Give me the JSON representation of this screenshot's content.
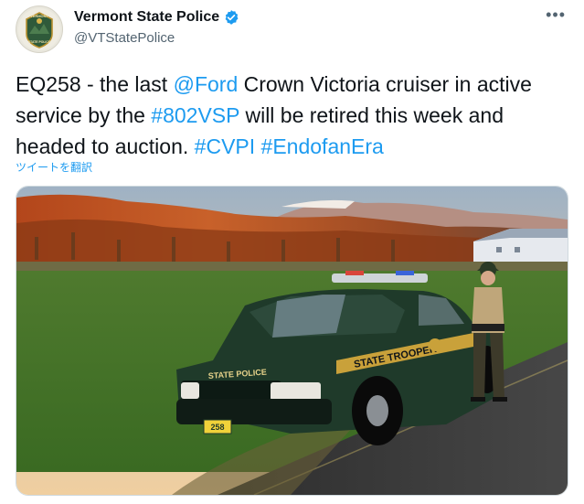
{
  "account": {
    "display_name": "Vermont State Police",
    "handle": "@VTStatePolice",
    "verified": true,
    "avatar_icon": "vermont-state-police-badge",
    "avatar_text_top": "VERMONT",
    "avatar_text_bottom": "STATE POLICE"
  },
  "menu": {
    "more_label": "•••"
  },
  "tweet": {
    "segments": [
      {
        "text": "EQ258 - the last ",
        "type": "text"
      },
      {
        "text": "@Ford",
        "type": "mention"
      },
      {
        "text": " Crown Victoria cruiser in active service by the ",
        "type": "text"
      },
      {
        "text": "#802VSP",
        "type": "hashtag"
      },
      {
        "text": " will be retired this week and headed to auction.  ",
        "type": "text"
      },
      {
        "text": "#CVPI",
        "type": "hashtag"
      },
      {
        "text": " ",
        "type": "text"
      },
      {
        "text": "#EndofanEra",
        "type": "hashtag"
      }
    ],
    "translate_label": "ツイートを翻訳"
  },
  "photo": {
    "car_door_text": "STATE TROOPER",
    "car_hood_text": "STATE POLICE",
    "plate_text": "258"
  },
  "colors": {
    "link": "#1d9bf0",
    "verified": "#1d9bf0",
    "cruiser_green": "#1f3a2a",
    "stripe_gold": "#c9a13a"
  }
}
